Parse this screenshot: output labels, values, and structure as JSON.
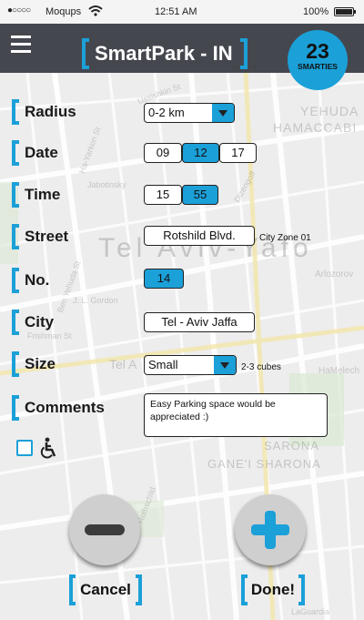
{
  "status_bar": {
    "signal": "●○○○○",
    "carrier": "Moqups",
    "time": "12:51 AM",
    "battery": "100%"
  },
  "header": {
    "title": "SmartPark - IN",
    "smarties_count": "23",
    "smarties_label": "SMARTIES"
  },
  "map": {
    "labels": [
      "Tel Aviv-Yafo",
      "YEHUDA",
      "HAMACCABI",
      "SARONA",
      "GANE'I SHARONA",
      "Arlozorov",
      "Ha-Yarkon St",
      "Ben Yehuda St",
      "Jabotinsky",
      "Ussishkin St",
      "Dizengoff",
      "J. L. Gordon",
      "Frishman St",
      "Tel A",
      "HaMelech",
      "Rothschild",
      "LaGuardia"
    ]
  },
  "form": {
    "radius": {
      "label": "Radius",
      "value": "0-2 km"
    },
    "date": {
      "label": "Date",
      "day": "09",
      "month": "12",
      "year": "17"
    },
    "time": {
      "label": "Time",
      "hour": "15",
      "minute": "55"
    },
    "street": {
      "label": "Street",
      "value": "Rotshild Blvd.",
      "zone": "City Zone 01"
    },
    "number": {
      "label": "No.",
      "value": "14"
    },
    "city": {
      "label": "City",
      "value": "Tel - Aviv Jaffa"
    },
    "size": {
      "label": "Size",
      "value": "Small",
      "note": "2-3 cubes"
    },
    "comments": {
      "label": "Comments",
      "value": "Easy Parking space would be appreciated :)"
    }
  },
  "accessibility": {
    "checked": false,
    "icon": "wheelchair-icon"
  },
  "actions": {
    "cancel_label": "Cancel",
    "done_label": "Done!"
  },
  "colors": {
    "accent": "#1ba0d8",
    "header": "#45474f",
    "button_gray": "#cfcfcf"
  }
}
